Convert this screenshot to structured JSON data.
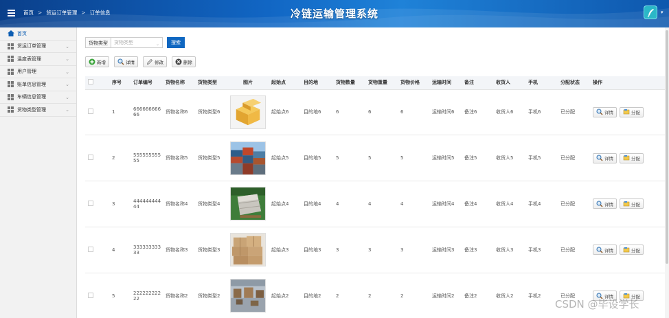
{
  "header": {
    "system_title": "冷链运输管理系统",
    "breadcrumb": [
      "首页",
      "货运订单管理",
      "订单信息"
    ],
    "breadcrumb_sep": ">",
    "accent": "#0f67c1"
  },
  "sidebar": {
    "items": [
      {
        "label": "首页",
        "icon": "home-icon"
      },
      {
        "label": "货运订单管理",
        "icon": "grid-icon"
      },
      {
        "label": "温度表管理",
        "icon": "grid-icon"
      },
      {
        "label": "用户管理",
        "icon": "grid-icon"
      },
      {
        "label": "账单信息管理",
        "icon": "grid-icon"
      },
      {
        "label": "车辆信息管理",
        "icon": "grid-icon"
      },
      {
        "label": "货物类型管理",
        "icon": "grid-icon"
      }
    ]
  },
  "search": {
    "label": "货物类型",
    "placeholder": "货物类型",
    "button": "搜索"
  },
  "toolbar": {
    "add": "新增",
    "detail": "详情",
    "edit": "修改",
    "delete": "删除"
  },
  "table": {
    "headers": [
      "",
      "序号",
      "订单编号",
      "货物名称",
      "货物类型",
      "图片",
      "起始点",
      "目的地",
      "货物数量",
      "货物重量",
      "货物价格",
      "运输时间",
      "备注",
      "收货人",
      "手机",
      "分配状态",
      "操作"
    ],
    "rows": [
      {
        "no": "1",
        "order_line1": "666666666",
        "order_line2": "66",
        "name": "货物名称6",
        "type": "货物类型6",
        "img": "boxes-yellow",
        "start": "起始点6",
        "dest": "目的地6",
        "qty": "6",
        "weight": "6",
        "price": "6",
        "time": "运输时间6",
        "remark": "备注6",
        "receiver": "收货人6",
        "phone": "手机6",
        "status": "已分配",
        "op_detail": "详情",
        "op_assign": "分配"
      },
      {
        "no": "2",
        "order_line1": "555555555",
        "order_line2": "55",
        "name": "货物名称5",
        "type": "货物类型5",
        "img": "containers",
        "start": "起始点5",
        "dest": "目的地5",
        "qty": "5",
        "weight": "5",
        "price": "5",
        "time": "运输时间5",
        "remark": "备注5",
        "receiver": "收货人5",
        "phone": "手机5",
        "status": "已分配",
        "op_detail": "详情",
        "op_assign": "分配"
      },
      {
        "no": "3",
        "order_line1": "444444444",
        "order_line2": "44",
        "name": "货物名称4",
        "type": "货物类型4",
        "img": "pallet-wrap",
        "start": "起始点4",
        "dest": "目的地4",
        "qty": "4",
        "weight": "4",
        "price": "4",
        "time": "运输时间4",
        "remark": "备注4",
        "receiver": "收货人4",
        "phone": "手机4",
        "status": "已分配",
        "op_detail": "详情",
        "op_assign": "分配"
      },
      {
        "no": "4",
        "order_line1": "333333333",
        "order_line2": "33",
        "name": "货物名称3",
        "type": "货物类型3",
        "img": "cardboard-stack",
        "start": "起始点3",
        "dest": "目的地3",
        "qty": "3",
        "weight": "3",
        "price": "3",
        "time": "运输时间3",
        "remark": "备注3",
        "receiver": "收货人3",
        "phone": "手机3",
        "status": "已分配",
        "op_detail": "详情",
        "op_assign": "分配"
      },
      {
        "no": "5",
        "order_line1": "222222222",
        "order_line2": "22",
        "name": "货物名称2",
        "type": "货物类型2",
        "img": "warehouse",
        "start": "起始点2",
        "dest": "目的地2",
        "qty": "2",
        "weight": "2",
        "price": "2",
        "time": "运输时间2",
        "remark": "备注2",
        "receiver": "收货人2",
        "phone": "手机2",
        "status": "已分配",
        "op_detail": "详情",
        "op_assign": "分配"
      }
    ]
  },
  "watermark": "CSDN @毕设学长"
}
